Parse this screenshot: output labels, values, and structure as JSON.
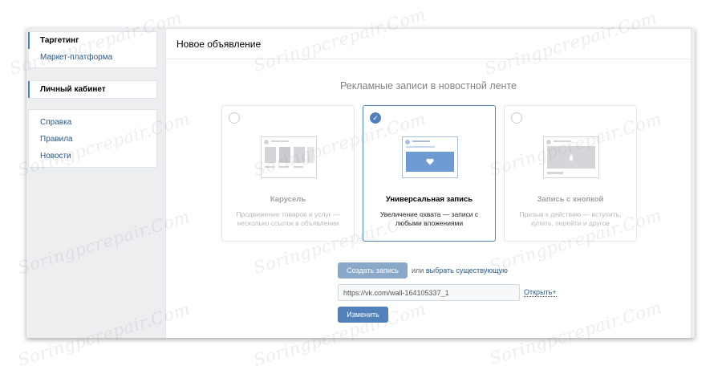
{
  "sidebar": {
    "group1": [
      {
        "label": "Таргетинг",
        "active": true
      },
      {
        "label": "Маркет-платформа",
        "active": false
      }
    ],
    "group2": [
      {
        "label": "Личный кабинет",
        "active": true
      }
    ],
    "group3": [
      {
        "label": "Справка"
      },
      {
        "label": "Правила"
      },
      {
        "label": "Новости"
      }
    ]
  },
  "main": {
    "header": "Новое объявление",
    "section_title": "Рекламные записи в новостной ленте",
    "options": [
      {
        "title": "Карусель",
        "desc": "Продвижение товаров и услуг — несколько ссылок в объявлении",
        "selected": false
      },
      {
        "title": "Универсальная запись",
        "desc": "Увеличение охвата — записи с любыми вложениями",
        "selected": true
      },
      {
        "title": "Запись с кнопкой",
        "desc": "Призыв к действию — вступить, купить, перейти и другое",
        "selected": false
      }
    ],
    "create_button": "Создать запись",
    "or_text": "или",
    "choose_existing": "выбрать существующую",
    "url_value": "https://vk.com/wall-164105337_1",
    "open_link": "Открыть",
    "change_button": "Изменить"
  },
  "watermark": "Soringpcrepair.Com",
  "colors": {
    "accent": "#5181b8",
    "accent_light": "#8aa9c9",
    "link": "#2a5885",
    "background": "#edeef0"
  }
}
